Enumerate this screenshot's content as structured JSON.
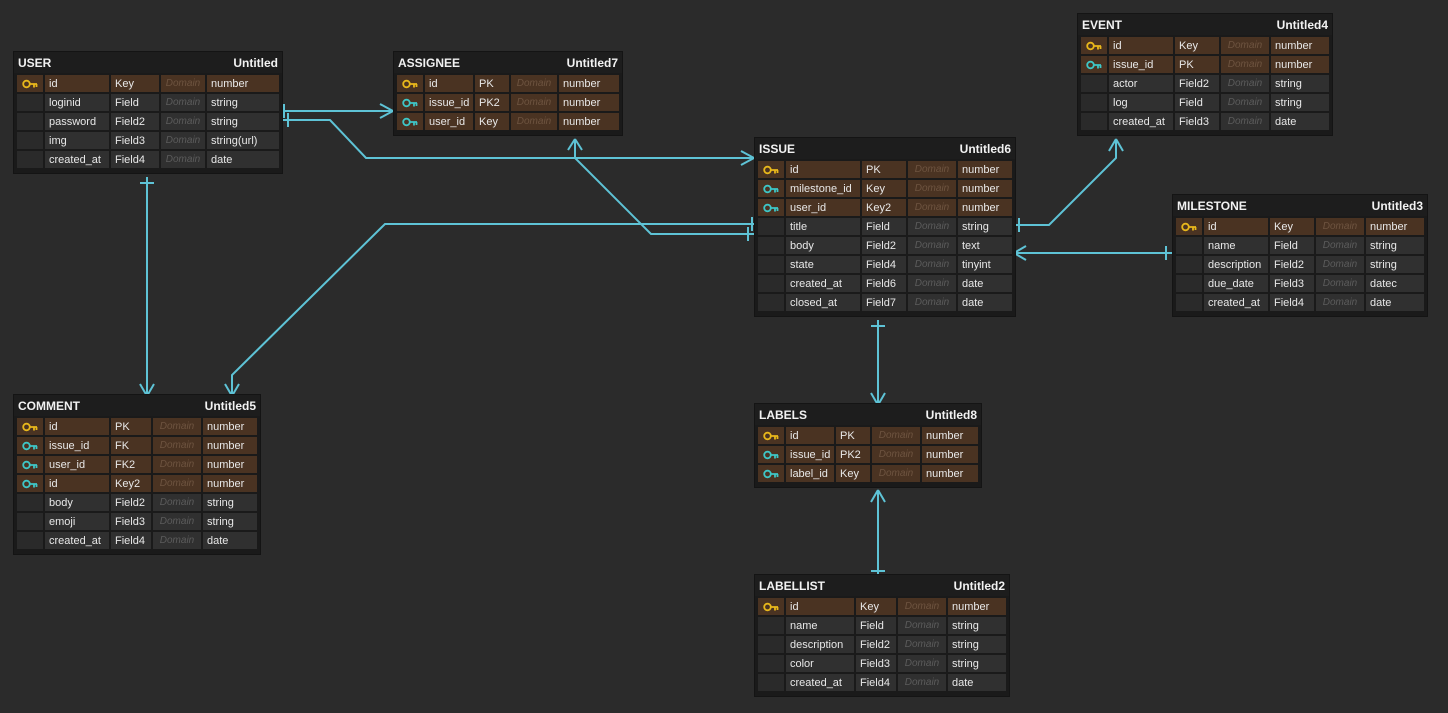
{
  "colors": {
    "background": "#2b2b2b",
    "connector": "#5ec3d6",
    "key_row": "#4a3322",
    "plain_row": "#303030",
    "primary_key_icon": "#e9b81b",
    "foreign_key_icon": "#3ec7c7"
  },
  "entities": {
    "user": {
      "name": "USER",
      "label": "Untitled",
      "rows": [
        {
          "icon": "primary-key-icon",
          "field": "id",
          "kind": "Key",
          "domain": "Domain",
          "type": "number"
        },
        {
          "icon": "",
          "field": "loginid",
          "kind": "Field",
          "domain": "Domain",
          "type": "string"
        },
        {
          "icon": "",
          "field": "password",
          "kind": "Field2",
          "domain": "Domain",
          "type": "string"
        },
        {
          "icon": "",
          "field": "img",
          "kind": "Field3",
          "domain": "Domain",
          "type": "string(url)"
        },
        {
          "icon": "",
          "field": "created_at",
          "kind": "Field4",
          "domain": "Domain",
          "type": "date"
        }
      ]
    },
    "assignee": {
      "name": "ASSIGNEE",
      "label": "Untitled7",
      "rows": [
        {
          "icon": "primary-key-icon",
          "field": "id",
          "kind": "PK",
          "domain": "Domain",
          "type": "number"
        },
        {
          "icon": "foreign-key-icon",
          "field": "issue_id",
          "kind": "PK2",
          "domain": "Domain",
          "type": "number"
        },
        {
          "icon": "foreign-key-icon",
          "field": "user_id",
          "kind": "Key",
          "domain": "Domain",
          "type": "number"
        }
      ]
    },
    "event": {
      "name": "EVENT",
      "label": "Untitled4",
      "rows": [
        {
          "icon": "primary-key-icon",
          "field": "id",
          "kind": "Key",
          "domain": "Domain",
          "type": "number"
        },
        {
          "icon": "foreign-key-icon",
          "field": "issue_id",
          "kind": "PK",
          "domain": "Domain",
          "type": "number"
        },
        {
          "icon": "",
          "field": "actor",
          "kind": "Field2",
          "domain": "Domain",
          "type": "string"
        },
        {
          "icon": "",
          "field": "log",
          "kind": "Field",
          "domain": "Domain",
          "type": "string"
        },
        {
          "icon": "",
          "field": "created_at",
          "kind": "Field3",
          "domain": "Domain",
          "type": "date"
        }
      ]
    },
    "issue": {
      "name": "ISSUE",
      "label": "Untitled6",
      "rows": [
        {
          "icon": "primary-key-icon",
          "field": "id",
          "kind": "PK",
          "domain": "Domain",
          "type": "number"
        },
        {
          "icon": "foreign-key-icon",
          "field": "milestone_id",
          "kind": "Key",
          "domain": "Domain",
          "type": "number"
        },
        {
          "icon": "foreign-key-icon",
          "field": "user_id",
          "kind": "Key2",
          "domain": "Domain",
          "type": "number"
        },
        {
          "icon": "",
          "field": "title",
          "kind": "Field",
          "domain": "Domain",
          "type": "string"
        },
        {
          "icon": "",
          "field": "body",
          "kind": "Field2",
          "domain": "Domain",
          "type": "text"
        },
        {
          "icon": "",
          "field": "state",
          "kind": "Field4",
          "domain": "Domain",
          "type": "tinyint"
        },
        {
          "icon": "",
          "field": "created_at",
          "kind": "Field6",
          "domain": "Domain",
          "type": "date"
        },
        {
          "icon": "",
          "field": "closed_at",
          "kind": "Field7",
          "domain": "Domain",
          "type": "date"
        }
      ]
    },
    "milestone": {
      "name": "MILESTONE",
      "label": "Untitled3",
      "rows": [
        {
          "icon": "primary-key-icon",
          "field": "id",
          "kind": "Key",
          "domain": "Domain",
          "type": "number"
        },
        {
          "icon": "",
          "field": "name",
          "kind": "Field",
          "domain": "Domain",
          "type": "string"
        },
        {
          "icon": "",
          "field": "description",
          "kind": "Field2",
          "domain": "Domain",
          "type": "string"
        },
        {
          "icon": "",
          "field": "due_date",
          "kind": "Field3",
          "domain": "Domain",
          "type": "datec"
        },
        {
          "icon": "",
          "field": "created_at",
          "kind": "Field4",
          "domain": "Domain",
          "type": "date"
        }
      ]
    },
    "comment": {
      "name": "COMMENT",
      "label": "Untitled5",
      "rows": [
        {
          "icon": "primary-key-icon",
          "field": "id",
          "kind": "PK",
          "domain": "Domain",
          "type": "number"
        },
        {
          "icon": "foreign-key-icon",
          "field": "issue_id",
          "kind": "FK",
          "domain": "Domain",
          "type": "number"
        },
        {
          "icon": "foreign-key-icon",
          "field": "user_id",
          "kind": "FK2",
          "domain": "Domain",
          "type": "number"
        },
        {
          "icon": "foreign-key-icon",
          "field": "id",
          "kind": "Key2",
          "domain": "Domain",
          "type": "number"
        },
        {
          "icon": "",
          "field": "body",
          "kind": "Field2",
          "domain": "Domain",
          "type": "string"
        },
        {
          "icon": "",
          "field": "emoji",
          "kind": "Field3",
          "domain": "Domain",
          "type": "string"
        },
        {
          "icon": "",
          "field": "created_at",
          "kind": "Field4",
          "domain": "Domain",
          "type": "date"
        }
      ]
    },
    "labels": {
      "name": "LABELS",
      "label": "Untitled8",
      "rows": [
        {
          "icon": "primary-key-icon",
          "field": "id",
          "kind": "PK",
          "domain": "Domain",
          "type": "number"
        },
        {
          "icon": "foreign-key-icon",
          "field": "issue_id",
          "kind": "PK2",
          "domain": "Domain",
          "type": "number"
        },
        {
          "icon": "foreign-key-icon",
          "field": "label_id",
          "kind": "Key",
          "domain": "Domain",
          "type": "number"
        }
      ]
    },
    "labellist": {
      "name": "LABELLIST",
      "label": "Untitled2",
      "rows": [
        {
          "icon": "primary-key-icon",
          "field": "id",
          "kind": "Key",
          "domain": "Domain",
          "type": "number"
        },
        {
          "icon": "",
          "field": "name",
          "kind": "Field",
          "domain": "Domain",
          "type": "string"
        },
        {
          "icon": "",
          "field": "description",
          "kind": "Field2",
          "domain": "Domain",
          "type": "string"
        },
        {
          "icon": "",
          "field": "color",
          "kind": "Field3",
          "domain": "Domain",
          "type": "string"
        },
        {
          "icon": "",
          "field": "created_at",
          "kind": "Field4",
          "domain": "Domain",
          "type": "date"
        }
      ]
    }
  }
}
